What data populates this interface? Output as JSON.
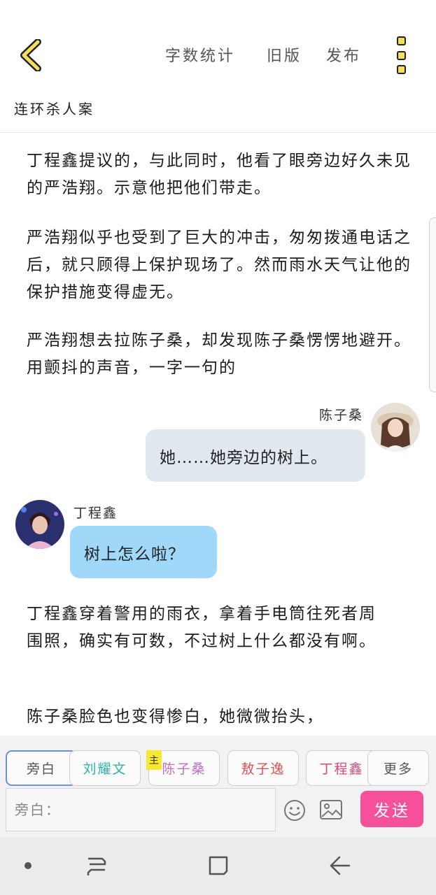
{
  "header": {
    "back_icon": "chevron-left-icon",
    "word_count_label": "字数统计",
    "old_version_label": "旧版",
    "publish_label": "发布",
    "more_icon": "more-vertical-icon",
    "story_title": "连环杀人案"
  },
  "content": {
    "paragraphs": [
      "丁程鑫提议的，与此同时，他看了眼旁边好久未见的严浩翔。示意他把他们带走。",
      "严浩翔似乎也受到了巨大的冲击，匆匆拨通电话之后，就只顾得上保护现场了。然而雨水天气让他的保护措施变得虚无。",
      "严浩翔想去拉陈子桑，却发现陈子桑愣愣地避开。用颤抖的声音，一字一句的"
    ],
    "messages": [
      {
        "speaker": "陈子桑",
        "text": "她……她旁边的树上。",
        "side": "right"
      },
      {
        "speaker": "丁程鑫",
        "text": "树上怎么啦？",
        "side": "left"
      }
    ],
    "narration_after": [
      "丁程鑫穿着警用的雨衣，拿着手电筒往死者周围照，确实有可数，不过树上什么都没有啊。",
      "陈子桑脸色也变得惨白，她微微抬头，"
    ]
  },
  "role_bar": {
    "tabs": [
      {
        "label": "旁白",
        "color": "#555555",
        "active": true
      },
      {
        "label": "刘耀文",
        "color": "#2fb3a7",
        "active": false
      },
      {
        "label": "陈子桑",
        "color": "#c06fc8",
        "active": false
      },
      {
        "label": "敖子逸",
        "color": "#d9534f",
        "active": false
      },
      {
        "label": "丁程鑫",
        "color": "#e0457b",
        "active": false
      },
      {
        "label": "更多",
        "color": "#555555",
        "active": false
      }
    ],
    "main_badge": "主",
    "input_placeholder": "旁白：",
    "emoji_icon": "smiley-icon",
    "image_icon": "image-icon",
    "send_label": "发送"
  },
  "colors": {
    "accent_yellow": "#f6de5c",
    "send_pink": "#f6509a",
    "bubble_right": "#e2e8f0",
    "bubble_left": "#9fd8f8"
  },
  "navbar": {
    "dot_icon": "dot-icon",
    "recents_icon": "recents-icon",
    "home_icon": "home-square-icon",
    "back_icon": "back-arrow-icon"
  }
}
